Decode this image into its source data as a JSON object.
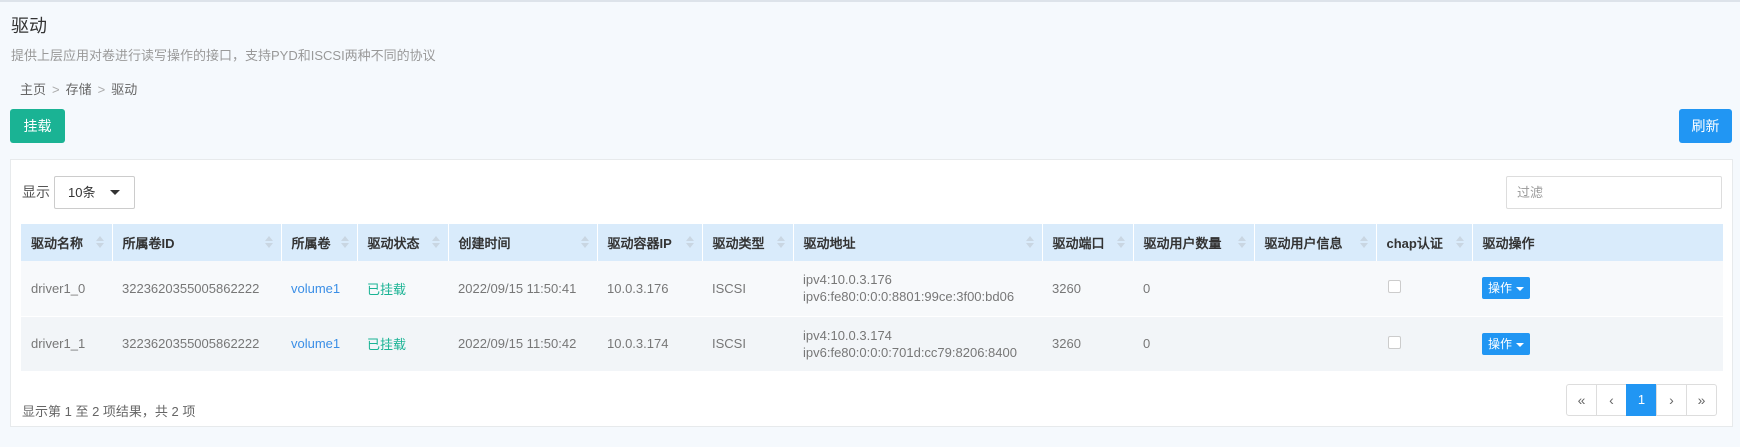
{
  "page": {
    "title": "驱动",
    "subtitle": "提供上层应用对卷进行读写操作的接口，支持PYD和ISCSI两种不同的协议"
  },
  "breadcrumb": {
    "home": "主页",
    "storage": "存储",
    "current": "驱动",
    "separator": ">"
  },
  "toolbar": {
    "mount_label": "挂载",
    "refresh_label": "刷新"
  },
  "table_controls": {
    "length_label": "显示",
    "length_value": "10条",
    "filter_placeholder": "过滤"
  },
  "columns": [
    "驱动名称",
    "所属卷ID",
    "所属卷",
    "驱动状态",
    "创建时间",
    "驱动容器IP",
    "驱动类型",
    "驱动地址",
    "驱动端口",
    "驱动用户数量",
    "驱动用户信息",
    "chap认证",
    "驱动操作"
  ],
  "rows": [
    {
      "name": "driver1_0",
      "volume_id": "3223620355005862222",
      "volume": "volume1",
      "status": "已挂载",
      "created": "2022/09/15 11:50:41",
      "container_ip": "10.0.3.176",
      "type": "ISCSI",
      "address_v4": "ipv4:10.0.3.176",
      "address_v6": "ipv6:fe80:0:0:0:8801:99ce:3f00:bd06",
      "port": "3260",
      "user_count": "0",
      "user_info": "",
      "op_label": "操作"
    },
    {
      "name": "driver1_1",
      "volume_id": "3223620355005862222",
      "volume": "volume1",
      "status": "已挂载",
      "created": "2022/09/15 11:50:42",
      "container_ip": "10.0.3.174",
      "type": "ISCSI",
      "address_v4": "ipv4:10.0.3.174",
      "address_v6": "ipv6:fe80:0:0:0:701d:cc79:8206:8400",
      "port": "3260",
      "user_count": "0",
      "user_info": "",
      "op_label": "操作"
    }
  ],
  "footer": {
    "info": "显示第 1 至 2 项结果，共 2 项"
  },
  "pagination": {
    "first": "«",
    "prev": "‹",
    "current": "1",
    "next": "›",
    "last": "»"
  },
  "colors": {
    "mount_button": "#1ab394",
    "primary": "#2196f3",
    "status_ok": "#1ab394",
    "header_bg": "#d9ebfb"
  }
}
